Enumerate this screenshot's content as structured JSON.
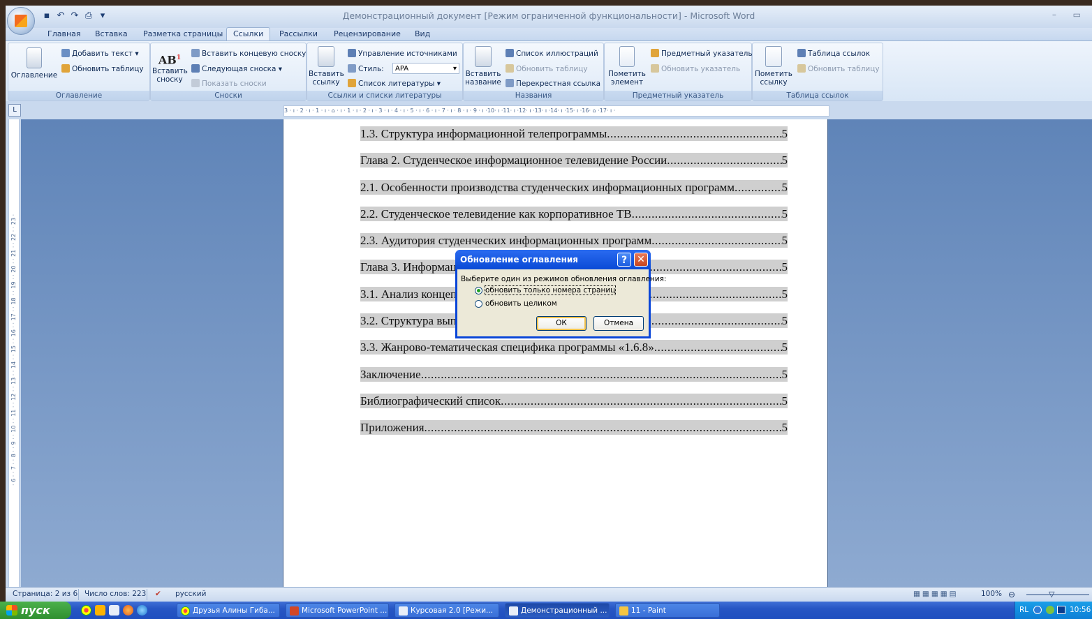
{
  "window": {
    "title": "Демонстрационный документ [Режим ограниченной функциональности] - Microsoft Word",
    "controls": "– ▭"
  },
  "ribbon_tabs": [
    "Главная",
    "Вставка",
    "Разметка страницы",
    "Ссылки",
    "Рассылки",
    "Рецензирование",
    "Вид"
  ],
  "active_tab": "Ссылки",
  "groups": {
    "toc": {
      "label": "Оглавление",
      "big": "Оглавление",
      "add_text": "Добавить текст",
      "update_table": "Обновить таблицу"
    },
    "footnotes": {
      "label": "Сноски",
      "insert_footnote": "Вставить сноску",
      "insert_endnote": "Вставить концевую сноску",
      "next_footnote": "Следующая сноска",
      "show_notes": "Показать сноски"
    },
    "citations": {
      "label": "Ссылки и списки литературы",
      "insert_citation": "Вставить ссылку",
      "manage_sources": "Управление источниками",
      "style_label": "Стиль:",
      "style_value": "APA",
      "bibliography": "Список литературы"
    },
    "captions": {
      "label": "Названия",
      "insert_caption": "Вставить название",
      "table_of_figures": "Список иллюстраций",
      "update_table": "Обновить таблицу",
      "cross_reference": "Перекрестная ссылка"
    },
    "index": {
      "label": "Предметный указатель",
      "mark_entry": "Пометить элемент",
      "insert_index": "Предметный указатель",
      "update_index": "Обновить указатель"
    },
    "toa": {
      "label": "Таблица ссылок",
      "mark_citation": "Пометить ссылку",
      "insert_toa": "Таблица ссылок",
      "update_table": "Обновить таблицу"
    }
  },
  "ruler_corner": "L",
  "ruler_text": "3 · ı · 2 · ı · 1 · ı · ⌂ · ı · 1 · ı · 2 · ı · 3 · ı · 4 · ı · 5 · ı · 6 · ı · 7 · ı · 8 · ı · 9 · ı ·10· ı ·11· ı ·12· ı ·13· ı ·14· ı ·15· ı ·16· ⌂ ·17· ı ·",
  "vruler_text": "· 6 · · 7 · · 8 · · 9 · · 10 · · 11 · · 12 · · 13 · · 14 · · 15 · · 16 · · 17 · · 18 · · 19 · · 20 · · 21 · · 22 · · 23 ·",
  "toc_entries": [
    {
      "title": "1.3. Структура информационной телепрограммы",
      "page": "5"
    },
    {
      "title": "Глава 2. Студенческое информационное телевидение России",
      "page": "5"
    },
    {
      "title": "2.1. Особенности производства студенческих информационных программ",
      "page": "5"
    },
    {
      "title": "2.2. Студенческое телевидение как корпоративное ТВ",
      "page": "5"
    },
    {
      "title": "2.3. Аудитория студенческих информационных программ",
      "page": "5"
    },
    {
      "title": "Глава 3. Информационная телепрограмма «1.6.8»",
      "page": "5"
    },
    {
      "title": "3.1. Анализ концепции телепрограммы «1.6.8»",
      "page": "5"
    },
    {
      "title": "3.2. Структура выпусков телепрограммы «1.6.8»",
      "page": "5"
    },
    {
      "title": "3.3. Жанрово-тематическая специфика программы «1.6.8»",
      "page": "5"
    },
    {
      "title": "Заключение",
      "page": "5"
    },
    {
      "title": "Библиографический список",
      "page": "5"
    },
    {
      "title": "Приложения",
      "page": "5"
    }
  ],
  "dialog": {
    "title": "Обновление оглавления",
    "help": "?",
    "close": "✕",
    "prompt": "Выберите один из режимов обновления оглавления:",
    "option_pages": "обновить только номера страниц",
    "option_full": "обновить целиком",
    "ok": "ОК",
    "cancel": "Отмена"
  },
  "status": {
    "page": "Страница: 2 из 6",
    "words": "Число слов: 223",
    "language": "русский",
    "zoom": "100%"
  },
  "taskbar": {
    "start": "пуск",
    "buttons": [
      "Друзья Алины Гиба...",
      "Microsoft PowerPoint ...",
      "Курсовая 2.0 [Режи...",
      "Демонстрационный ...",
      "11 - Paint"
    ],
    "tray_lang": "RL",
    "clock": "10:56"
  },
  "colors": {
    "highlight": "#cfcfcf",
    "dialog_blue": "#0a46d8",
    "taskbar": "#2756c4"
  }
}
